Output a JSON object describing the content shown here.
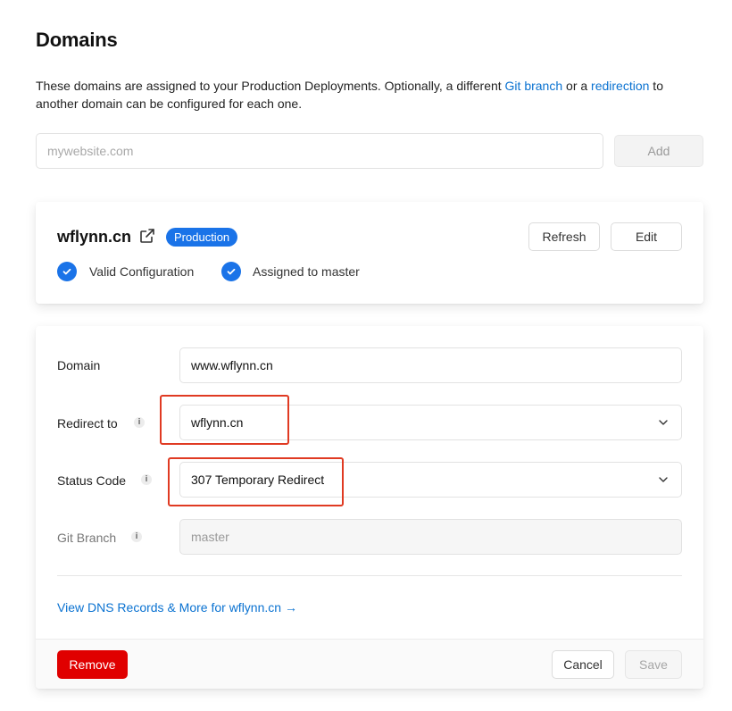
{
  "page": {
    "title": "Domains",
    "description": {
      "part1": "These domains are assigned to your Production Deployments. Optionally, a different ",
      "link_git_branch": "Git branch",
      "part2": " or a ",
      "link_redirection": "redirection",
      "part3": " to another domain can be configured for each one."
    }
  },
  "add_domain": {
    "placeholder": "mywebsite.com",
    "button_label": "Add"
  },
  "domain_card": {
    "name": "wflynn.cn",
    "badge": "Production",
    "refresh_label": "Refresh",
    "edit_label": "Edit",
    "status_items": [
      {
        "label": "Valid Configuration"
      },
      {
        "label": "Assigned to master"
      }
    ]
  },
  "edit_form": {
    "domain": {
      "label": "Domain",
      "value": "www.wflynn.cn"
    },
    "redirect_to": {
      "label": "Redirect to",
      "value": "wflynn.cn"
    },
    "status_code": {
      "label": "Status Code",
      "value": "307 Temporary Redirect"
    },
    "git_branch": {
      "label": "Git Branch",
      "placeholder": "master"
    },
    "dns_link": "View DNS Records & More for wflynn.cn →",
    "remove_label": "Remove",
    "cancel_label": "Cancel",
    "save_label": "Save"
  },
  "colors": {
    "accent": "#1a73e8",
    "link": "#0a72d1",
    "danger": "#e00000",
    "annotation": "#e03a22"
  },
  "icons": {
    "external": "external-link-icon",
    "check": "check-circle-icon",
    "info": "info-icon",
    "dropdown": "chevron-down-icon"
  }
}
